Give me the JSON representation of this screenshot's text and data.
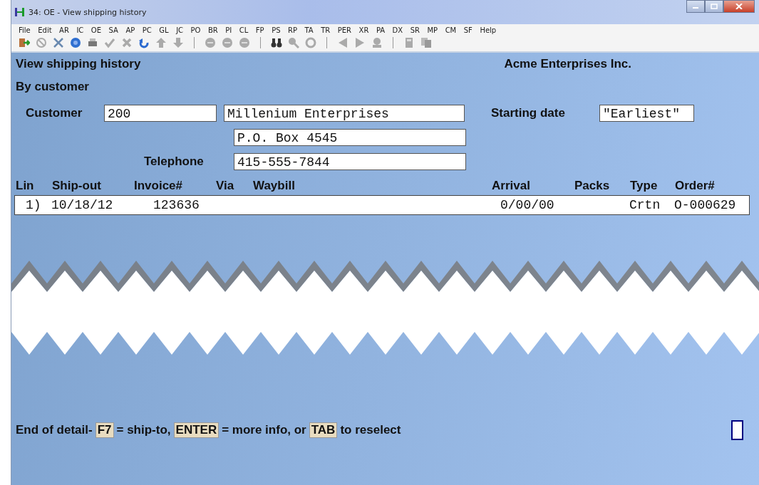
{
  "window": {
    "title": "34: OE - View shipping history"
  },
  "menu": [
    "File",
    "Edit",
    "AR",
    "IC",
    "OE",
    "SA",
    "AP",
    "PC",
    "GL",
    "JC",
    "PO",
    "BR",
    "PI",
    "CL",
    "FP",
    "PS",
    "RP",
    "TA",
    "TR",
    "PER",
    "XR",
    "PA",
    "DX",
    "SR",
    "MP",
    "CM",
    "SF",
    "Help"
  ],
  "screen": {
    "title": "View shipping history",
    "company": "Acme Enterprises Inc.",
    "subtitle": "By customer"
  },
  "form": {
    "customer_label": "Customer",
    "customer": "200",
    "name": "Millenium Enterprises",
    "address": "P.O. Box 4545",
    "telephone_label": "Telephone",
    "telephone": "415-555-7844",
    "starting_date_label": "Starting date",
    "starting_date": "\"Earliest\""
  },
  "table": {
    "columns": [
      "Lin",
      "Ship-out",
      "Invoice#",
      "Via",
      "Waybill",
      "Arrival",
      "Packs",
      "Type",
      "Order#"
    ],
    "rows": [
      {
        "lin": "1)",
        "ship_out": "10/18/12",
        "invoice": "123636",
        "arrival": "0/00/00",
        "type": "Crtn",
        "order": "O-000629"
      }
    ]
  },
  "prompt": [
    {
      "kind": "text",
      "text": "End of detail-"
    },
    {
      "kind": "key",
      "text": "F7"
    },
    {
      "kind": "text",
      "text": "= ship-to,"
    },
    {
      "kind": "key",
      "text": "ENTER"
    },
    {
      "kind": "text",
      "text": "= more info, or"
    },
    {
      "kind": "key",
      "text": "TAB"
    },
    {
      "kind": "text",
      "text": "to reselect"
    }
  ]
}
